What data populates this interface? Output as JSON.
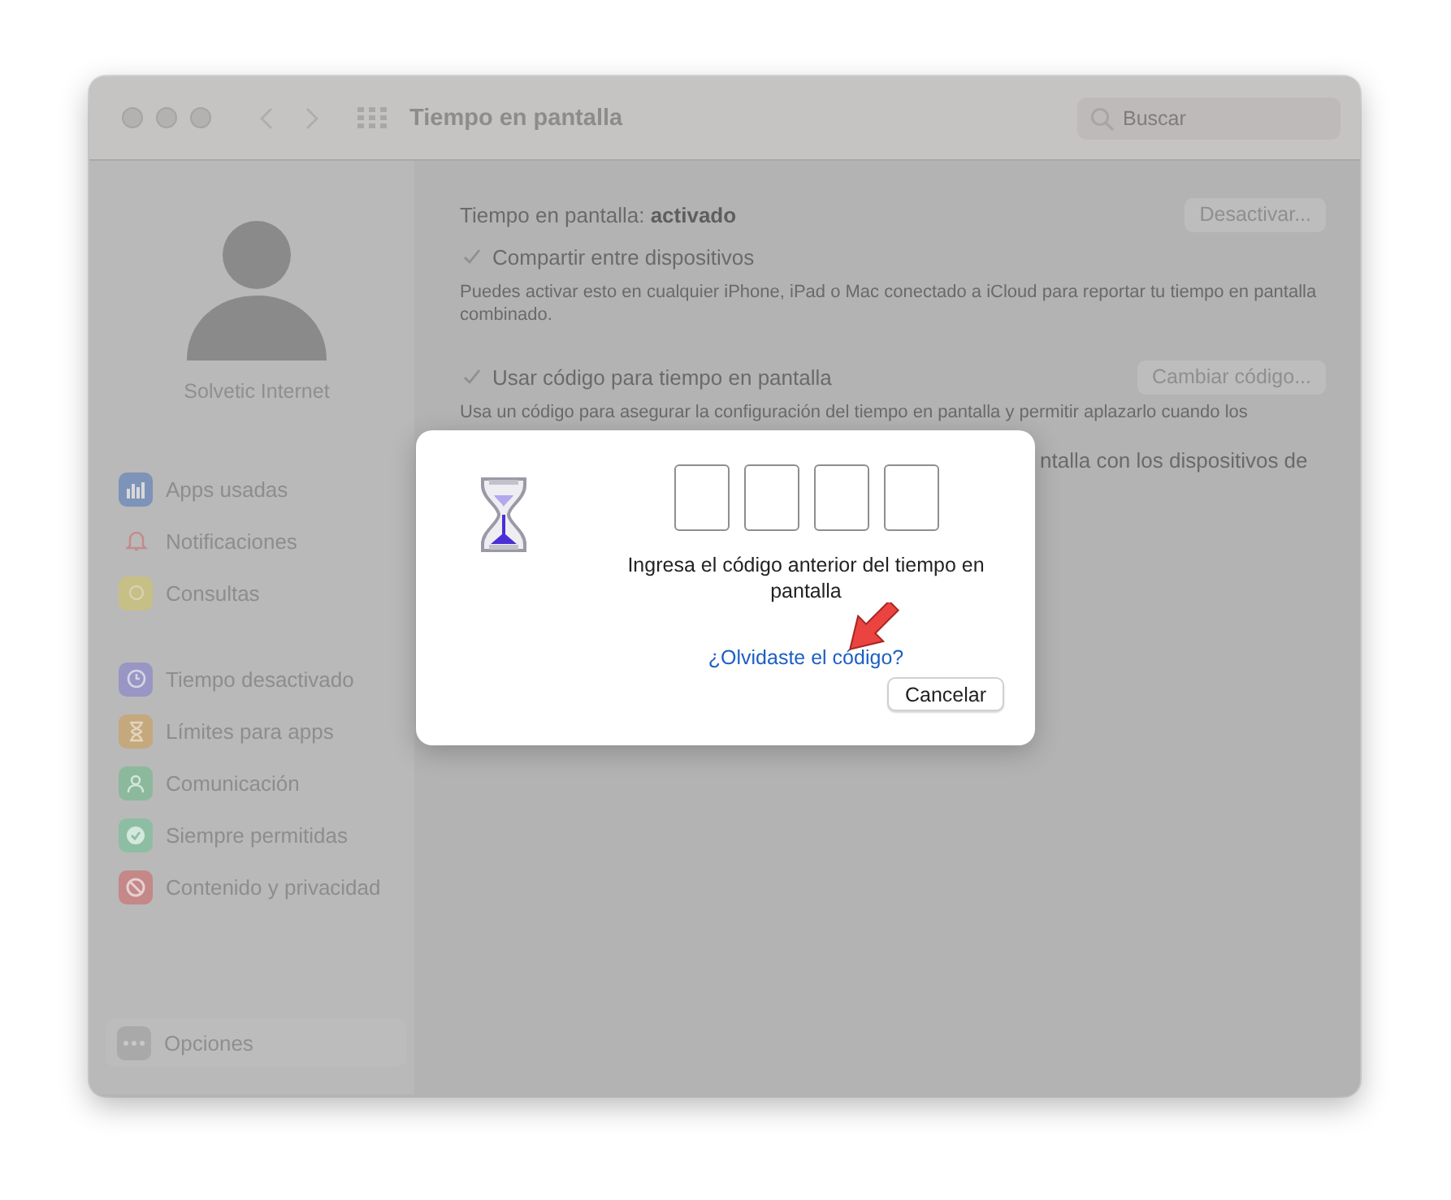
{
  "window": {
    "title": "Tiempo en pantalla",
    "search": {
      "placeholder": "Buscar"
    }
  },
  "sidebar": {
    "user": "Solvetic Internet",
    "sections": [
      {
        "items": [
          {
            "label": "Apps usadas",
            "kind": "chart",
            "color": "#7d93b8"
          },
          {
            "label": "Notificaciones",
            "kind": "bell",
            "color": "#b9b9b9"
          },
          {
            "label": "Consultas",
            "kind": "dot",
            "color": "#c6bf86"
          }
        ]
      },
      {
        "items": [
          {
            "label": "Tiempo desactivado",
            "kind": "clock",
            "color": "#9995c4"
          },
          {
            "label": "Límites para apps",
            "kind": "hourglass",
            "color": "#c5a87c"
          },
          {
            "label": "Comunicación",
            "kind": "person",
            "color": "#8cb99c"
          },
          {
            "label": "Siempre permitidas",
            "kind": "check",
            "color": "#8dbea3"
          },
          {
            "label": "Contenido y privacidad",
            "kind": "prohibited",
            "color": "#c48888"
          }
        ]
      }
    ],
    "footer": {
      "label": "Opciones"
    }
  },
  "main": {
    "status_label": "Tiempo en pantalla:",
    "status_value": "activado",
    "status_button": "Desactivar...",
    "options": [
      {
        "label": "Compartir entre dispositivos",
        "checked": true,
        "description": "Puedes activar esto en cualquier iPhone, iPad o Mac conectado a iCloud para reportar tu tiempo en pantalla combinado."
      },
      {
        "label": "Usar código para tiempo en pantalla",
        "checked": true,
        "button": "Cambiar código...",
        "description": "Usa un código para asegurar la configuración del tiempo en pantalla y permitir aplazarlo cuando los"
      }
    ],
    "partial_row_text": "ntalla con los dispositivos de"
  },
  "dialog": {
    "code_fields": [
      {
        "filled": false
      },
      {
        "filled": false
      },
      {
        "filled": false
      },
      {
        "filled": false
      }
    ],
    "message": "Ingresa el código anterior del tiempo en pantalla",
    "link": "¿Olvidaste el código?",
    "button": "Cancelar"
  }
}
